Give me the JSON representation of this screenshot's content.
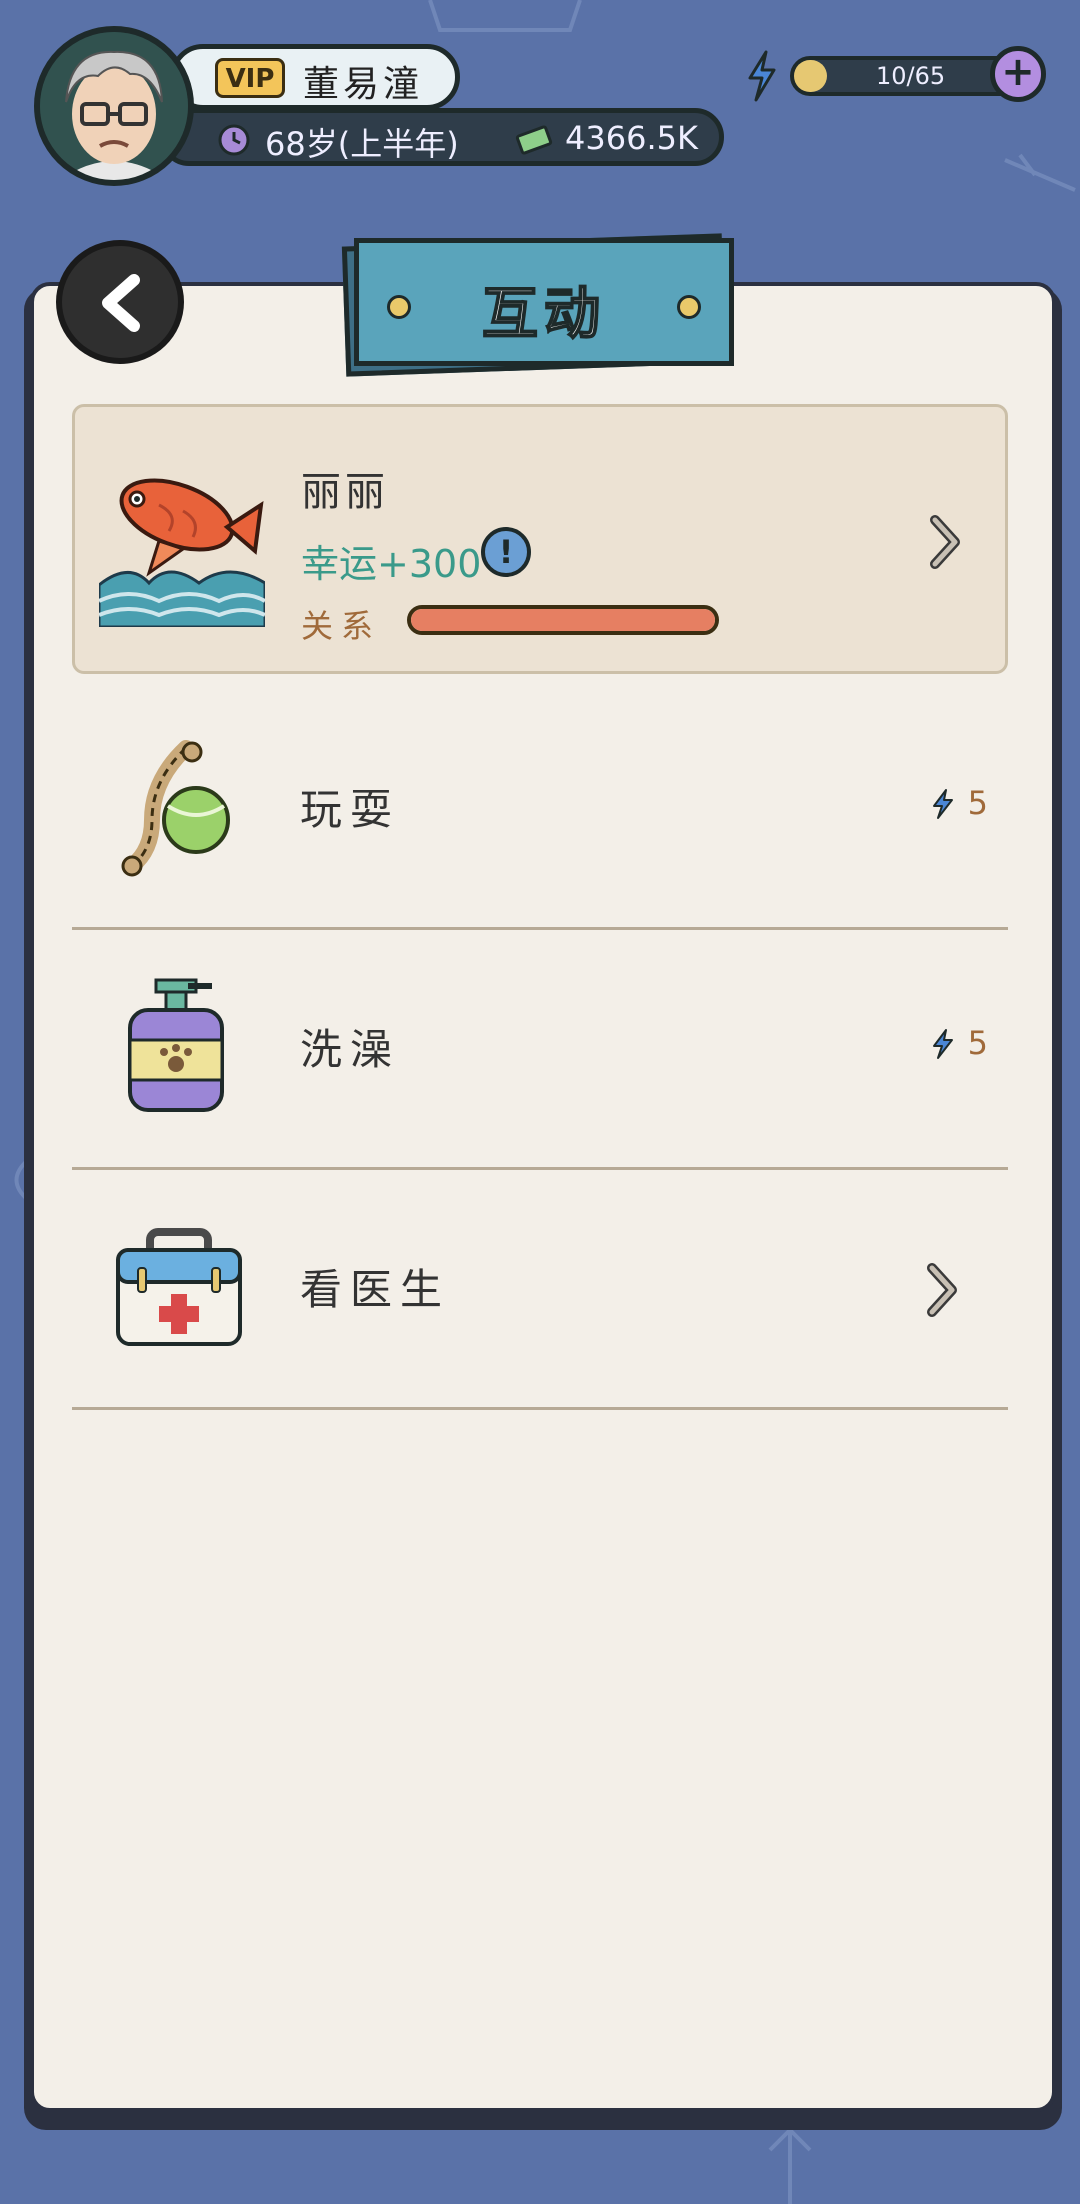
{
  "header": {
    "vip_label": "VIP",
    "player_name": "董易潼",
    "age_text": "68岁(上半年)",
    "money_text": "4366.5K",
    "energy_text": "10/65",
    "energy_fill": 0.15,
    "plus_label": "+"
  },
  "page": {
    "title": "互动"
  },
  "pet": {
    "name": "丽丽",
    "luck_text": "幸运+300",
    "info_glyph": "!",
    "relation_label": "关系",
    "relation_fill": 1.0
  },
  "actions": [
    {
      "label": "玩耍",
      "cost": "5"
    },
    {
      "label": "洗澡",
      "cost": "5"
    },
    {
      "label": "看医生"
    }
  ],
  "colors": {
    "background": "#5a72a8",
    "paper": "#f3efe8",
    "title_tag": "#5aa4bb",
    "luck_text": "#3a9a8a",
    "relation_fill": "#e67f62",
    "energy_icon": "#4a86d6"
  },
  "icons": {
    "back": "chevron-left-icon",
    "pet": "koi-fish-icon",
    "play": "rope-ball-toy-icon",
    "bath": "shampoo-bottle-icon",
    "doctor": "first-aid-kit-icon",
    "energy": "lightning-icon",
    "money": "cash-icon",
    "age": "clock-icon"
  }
}
